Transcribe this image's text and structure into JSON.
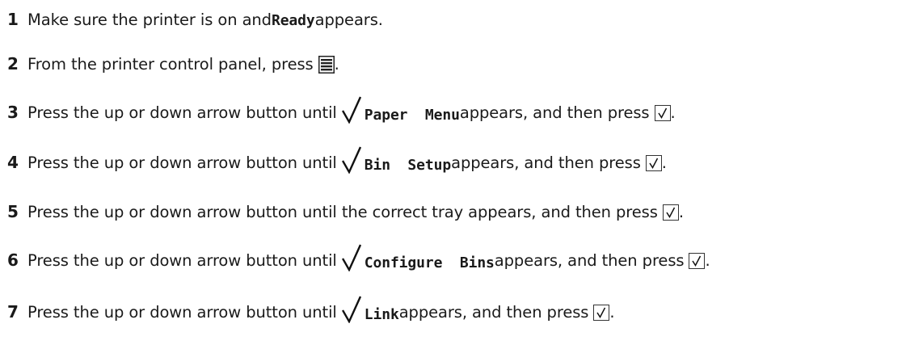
{
  "steps": [
    {
      "number": "1",
      "parts": [
        "Make sure the printer is on and ",
        "Ready",
        " appears."
      ]
    },
    {
      "number": "2",
      "parts": [
        "From the printer control panel, press ",
        "."
      ],
      "icon": "menu-icon"
    },
    {
      "number": "3",
      "parts": [
        "Press the up or down arrow button until ",
        "Paper  Menu",
        " appears, and then press ",
        "."
      ],
      "icons": [
        "checkmark-icon",
        "select-button-icon"
      ]
    },
    {
      "number": "4",
      "parts": [
        "Press the up or down arrow button until ",
        "Bin  Setup",
        " appears, and then press ",
        "."
      ],
      "icons": [
        "checkmark-icon",
        "select-button-icon"
      ]
    },
    {
      "number": "5",
      "parts": [
        "Press the up or down arrow button until the correct tray appears, and then press ",
        "."
      ],
      "icons": [
        "select-button-icon"
      ]
    },
    {
      "number": "6",
      "parts": [
        "Press the up or down arrow button until ",
        "Configure  Bins",
        " appears, and then press ",
        "."
      ],
      "icons": [
        "checkmark-icon",
        "select-button-icon"
      ]
    },
    {
      "number": "7",
      "parts": [
        "Press the up or down arrow button until ",
        "Link",
        " appears, and then press ",
        "."
      ],
      "icons": [
        "checkmark-icon",
        "select-button-icon"
      ]
    }
  ]
}
